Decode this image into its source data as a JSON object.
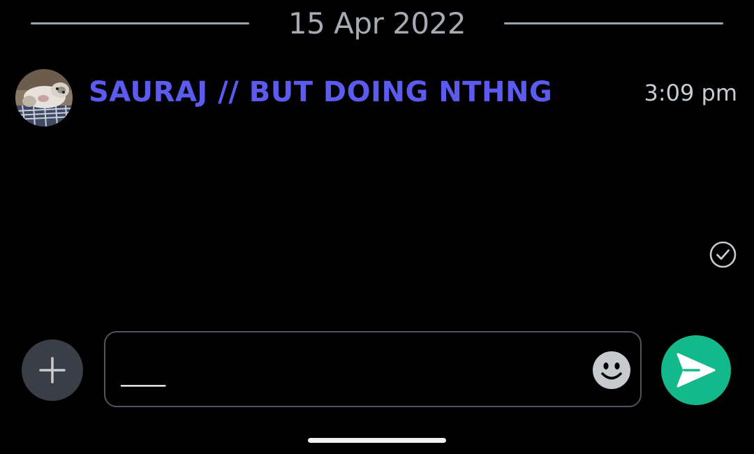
{
  "date_divider": {
    "label": "15 Apr 2022"
  },
  "message": {
    "sender_name": "SAURAJ // BUT DOING NTHNG",
    "timestamp": "3:09 pm",
    "status_icon": "check-circle-icon"
  },
  "composer": {
    "add_icon": "plus-icon",
    "input_value": "____",
    "emoji_icon": "smiley-icon",
    "send_icon": "send-arrow-icon"
  },
  "colors": {
    "background": "#000000",
    "sender_accent": "#5b5bf0",
    "send_button": "#13b98a",
    "add_button": "#3a3f47",
    "muted_text": "#a6abb3"
  }
}
